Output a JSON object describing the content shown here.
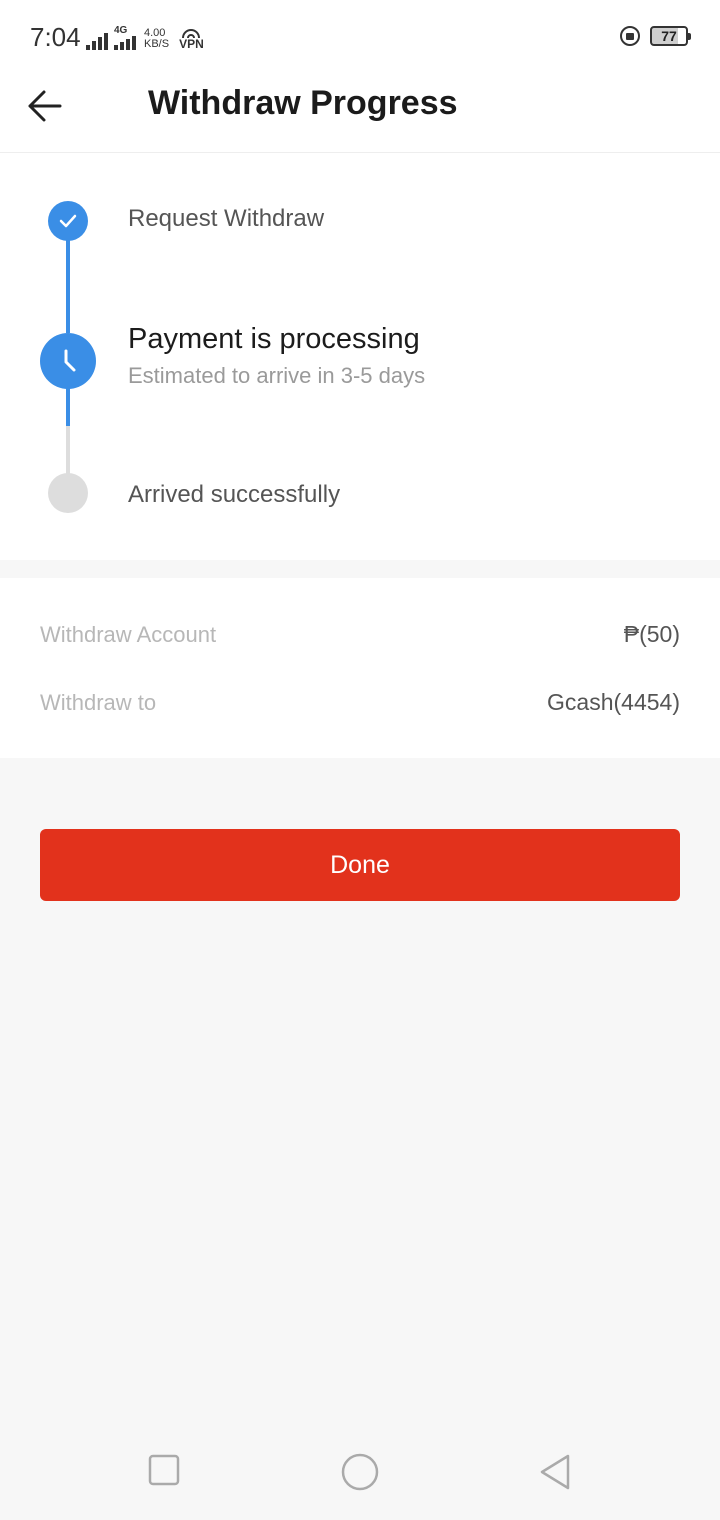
{
  "status_bar": {
    "time": "7:04",
    "network_type": "4G",
    "speed_value": "4.00",
    "speed_unit": "KB/S",
    "vpn_label": "VPN",
    "battery_level": "77"
  },
  "header": {
    "title": "Withdraw Progress",
    "back_icon": "arrow-left-icon"
  },
  "progress": {
    "steps": [
      {
        "label": "Request Withdraw",
        "status": "done",
        "icon": "check-icon"
      },
      {
        "label": "Payment is processing",
        "sub": "Estimated to arrive in 3-5 days",
        "status": "current",
        "icon": "clock-icon"
      },
      {
        "label": "Arrived successfully",
        "status": "pending"
      }
    ],
    "colors": {
      "active": "#3a8ee6",
      "inactive": "#dddddd"
    }
  },
  "details": {
    "rows": [
      {
        "label": "Withdraw Account",
        "value": "₱(50)"
      },
      {
        "label": "Withdraw to",
        "value": "Gcash(4454)"
      }
    ]
  },
  "actions": {
    "done_label": "Done",
    "done_color": "#e2321c"
  },
  "nav_bar": {
    "icons": [
      "recent-apps-icon",
      "home-icon",
      "back-icon"
    ]
  }
}
